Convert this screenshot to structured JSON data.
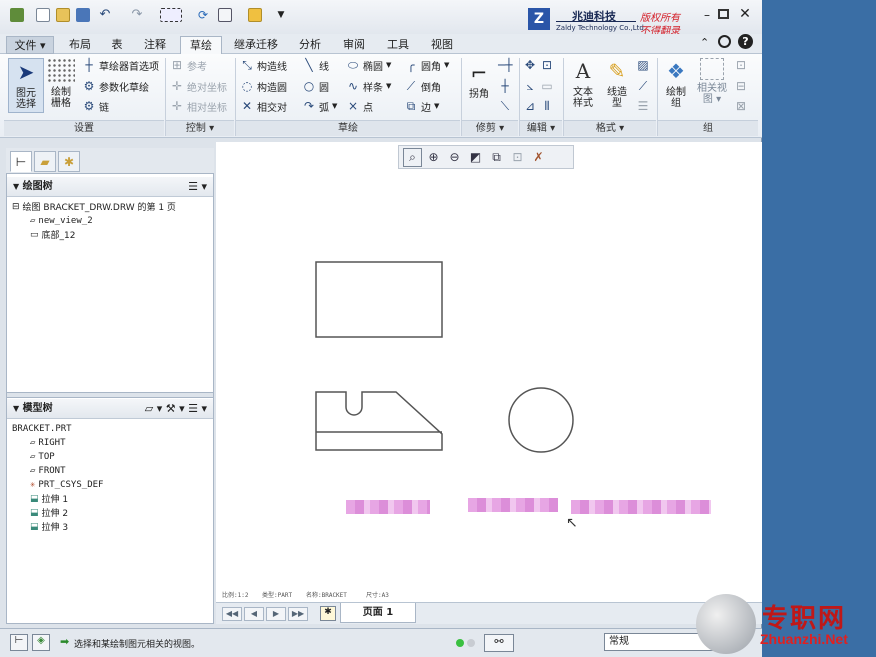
{
  "header": {
    "brand_name": "兆迪科技",
    "brand_sub": "Zaldy Technology Co.,Ltd.",
    "copyright_line1": "版权所有",
    "copyright_line2": "不得翻录"
  },
  "tabs": [
    {
      "label": "文件 ▾",
      "active": false
    },
    {
      "label": "布局",
      "active": false
    },
    {
      "label": "表",
      "active": false
    },
    {
      "label": "注释",
      "active": false
    },
    {
      "label": "草绘",
      "active": true
    },
    {
      "label": "继承迁移",
      "active": false
    },
    {
      "label": "分析",
      "active": false
    },
    {
      "label": "审阅",
      "active": false
    },
    {
      "label": "工具",
      "active": false
    },
    {
      "label": "视图",
      "active": false
    }
  ],
  "ribbon": {
    "settings": {
      "select_line1": "图元",
      "select_line2": "选择",
      "grid_line1": "绘制",
      "grid_line2": "栅格",
      "prefs": "草绘器首选项",
      "param_sketch": "参数化草绘",
      "chain": "链",
      "label": "设置"
    },
    "control": {
      "ref": "参考",
      "abs_coord": "绝对坐标",
      "rel_coord": "相对坐标",
      "label": "控制 ▾"
    },
    "sketch": {
      "construct_line": "构造线",
      "construct_circle": "构造圆",
      "intersect": "相交对",
      "line": "线",
      "circle": "圆",
      "arc": "弧",
      "ellipse": "椭圆",
      "spline": "样条",
      "point": "点",
      "fillet": "圆角",
      "chamfer": "倒角",
      "edge": "边",
      "label": "草绘"
    },
    "trim": {
      "corner": "拐角",
      "label": "修剪 ▾"
    },
    "edit": {
      "label": "编辑 ▾"
    },
    "format": {
      "text_style_line1": "文本",
      "text_style_line2": "样式",
      "line_style_line1": "线造",
      "line_style_line2": "型",
      "label": "格式 ▾"
    },
    "group": {
      "draw_group_line1": "绘制",
      "draw_group_line2": "组",
      "rel_view_line1": "相关视",
      "rel_view_line2": "图 ▾",
      "label": "组"
    }
  },
  "drawing_tree": {
    "title": "绘图树",
    "items": [
      {
        "text": "绘图 BRACKET_DRW.DRW 的第 1 页",
        "indent": 0
      },
      {
        "text": "new_view_2",
        "indent": 1
      },
      {
        "text": "底部_12",
        "indent": 1
      }
    ]
  },
  "model_tree": {
    "title": "模型树",
    "items": [
      {
        "text": "BRACKET.PRT",
        "indent": 0
      },
      {
        "text": "RIGHT",
        "indent": 1
      },
      {
        "text": "TOP",
        "indent": 1
      },
      {
        "text": "FRONT",
        "indent": 1
      },
      {
        "text": "PRT_CSYS_DEF",
        "indent": 1
      },
      {
        "text": "拉伸 1",
        "indent": 1
      },
      {
        "text": "拉伸 2",
        "indent": 1
      },
      {
        "text": "拉伸 3",
        "indent": 1
      }
    ]
  },
  "canvas": {
    "info_scale": "比例:1:2",
    "info_type": "类型:PART",
    "info_name": "名称:BRACKET",
    "info_size": "尺寸:A3"
  },
  "pagebar": {
    "page_label": "页面 1"
  },
  "status": {
    "message": "选择和某绘制图元相关的视图。",
    "filter_value": "常规"
  },
  "watermark": {
    "cn": "专职网",
    "en": "Zhuanzhi.Net"
  }
}
